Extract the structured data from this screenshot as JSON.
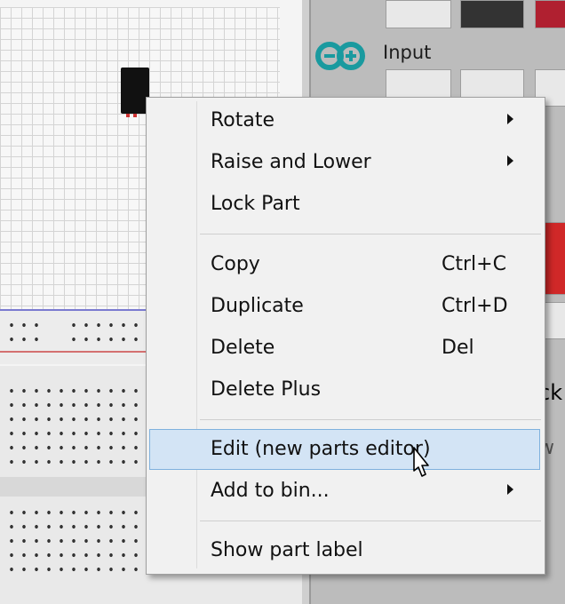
{
  "parts_bin": {
    "category_label": "Input",
    "partial_label_right": "ck",
    "partial_label_right2": "w"
  },
  "context_menu": {
    "items": [
      {
        "label": "Rotate",
        "shortcut": "",
        "submenu": true
      },
      {
        "label": "Raise and Lower",
        "shortcut": "",
        "submenu": true
      },
      {
        "label": "Lock Part",
        "shortcut": "",
        "submenu": false
      },
      {
        "label": "Copy",
        "shortcut": "Ctrl+C",
        "submenu": false
      },
      {
        "label": "Duplicate",
        "shortcut": "Ctrl+D",
        "submenu": false
      },
      {
        "label": "Delete",
        "shortcut": "Del",
        "submenu": false
      },
      {
        "label": "Delete Plus",
        "shortcut": "",
        "submenu": false
      },
      {
        "label": "Edit (new parts editor)",
        "shortcut": "",
        "submenu": false,
        "highlighted": true
      },
      {
        "label": "Add to bin...",
        "shortcut": "",
        "submenu": true
      },
      {
        "label": "Show part label",
        "shortcut": "",
        "submenu": false
      }
    ]
  },
  "colors": {
    "highlight_fill": "#d3e4f5",
    "highlight_border": "#7fb1de",
    "arduino_teal": "#1a9a9f"
  },
  "icons": [
    "arduino-logo-icon",
    "submenu-arrow-icon",
    "mouse-pointer-icon",
    "breadboard-part-icon"
  ]
}
